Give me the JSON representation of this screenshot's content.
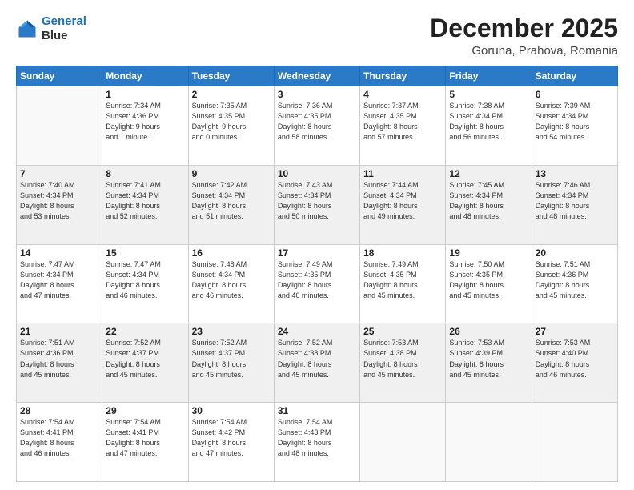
{
  "header": {
    "logo_line1": "General",
    "logo_line2": "Blue",
    "title": "December 2025",
    "subtitle": "Goruna, Prahova, Romania"
  },
  "weekdays": [
    "Sunday",
    "Monday",
    "Tuesday",
    "Wednesday",
    "Thursday",
    "Friday",
    "Saturday"
  ],
  "rows": [
    [
      {
        "day": "",
        "info": ""
      },
      {
        "day": "1",
        "info": "Sunrise: 7:34 AM\nSunset: 4:36 PM\nDaylight: 9 hours\nand 1 minute."
      },
      {
        "day": "2",
        "info": "Sunrise: 7:35 AM\nSunset: 4:35 PM\nDaylight: 9 hours\nand 0 minutes."
      },
      {
        "day": "3",
        "info": "Sunrise: 7:36 AM\nSunset: 4:35 PM\nDaylight: 8 hours\nand 58 minutes."
      },
      {
        "day": "4",
        "info": "Sunrise: 7:37 AM\nSunset: 4:35 PM\nDaylight: 8 hours\nand 57 minutes."
      },
      {
        "day": "5",
        "info": "Sunrise: 7:38 AM\nSunset: 4:34 PM\nDaylight: 8 hours\nand 56 minutes."
      },
      {
        "day": "6",
        "info": "Sunrise: 7:39 AM\nSunset: 4:34 PM\nDaylight: 8 hours\nand 54 minutes."
      }
    ],
    [
      {
        "day": "7",
        "info": "Sunrise: 7:40 AM\nSunset: 4:34 PM\nDaylight: 8 hours\nand 53 minutes."
      },
      {
        "day": "8",
        "info": "Sunrise: 7:41 AM\nSunset: 4:34 PM\nDaylight: 8 hours\nand 52 minutes."
      },
      {
        "day": "9",
        "info": "Sunrise: 7:42 AM\nSunset: 4:34 PM\nDaylight: 8 hours\nand 51 minutes."
      },
      {
        "day": "10",
        "info": "Sunrise: 7:43 AM\nSunset: 4:34 PM\nDaylight: 8 hours\nand 50 minutes."
      },
      {
        "day": "11",
        "info": "Sunrise: 7:44 AM\nSunset: 4:34 PM\nDaylight: 8 hours\nand 49 minutes."
      },
      {
        "day": "12",
        "info": "Sunrise: 7:45 AM\nSunset: 4:34 PM\nDaylight: 8 hours\nand 48 minutes."
      },
      {
        "day": "13",
        "info": "Sunrise: 7:46 AM\nSunset: 4:34 PM\nDaylight: 8 hours\nand 48 minutes."
      }
    ],
    [
      {
        "day": "14",
        "info": "Sunrise: 7:47 AM\nSunset: 4:34 PM\nDaylight: 8 hours\nand 47 minutes."
      },
      {
        "day": "15",
        "info": "Sunrise: 7:47 AM\nSunset: 4:34 PM\nDaylight: 8 hours\nand 46 minutes."
      },
      {
        "day": "16",
        "info": "Sunrise: 7:48 AM\nSunset: 4:34 PM\nDaylight: 8 hours\nand 46 minutes."
      },
      {
        "day": "17",
        "info": "Sunrise: 7:49 AM\nSunset: 4:35 PM\nDaylight: 8 hours\nand 46 minutes."
      },
      {
        "day": "18",
        "info": "Sunrise: 7:49 AM\nSunset: 4:35 PM\nDaylight: 8 hours\nand 45 minutes."
      },
      {
        "day": "19",
        "info": "Sunrise: 7:50 AM\nSunset: 4:35 PM\nDaylight: 8 hours\nand 45 minutes."
      },
      {
        "day": "20",
        "info": "Sunrise: 7:51 AM\nSunset: 4:36 PM\nDaylight: 8 hours\nand 45 minutes."
      }
    ],
    [
      {
        "day": "21",
        "info": "Sunrise: 7:51 AM\nSunset: 4:36 PM\nDaylight: 8 hours\nand 45 minutes."
      },
      {
        "day": "22",
        "info": "Sunrise: 7:52 AM\nSunset: 4:37 PM\nDaylight: 8 hours\nand 45 minutes."
      },
      {
        "day": "23",
        "info": "Sunrise: 7:52 AM\nSunset: 4:37 PM\nDaylight: 8 hours\nand 45 minutes."
      },
      {
        "day": "24",
        "info": "Sunrise: 7:52 AM\nSunset: 4:38 PM\nDaylight: 8 hours\nand 45 minutes."
      },
      {
        "day": "25",
        "info": "Sunrise: 7:53 AM\nSunset: 4:38 PM\nDaylight: 8 hours\nand 45 minutes."
      },
      {
        "day": "26",
        "info": "Sunrise: 7:53 AM\nSunset: 4:39 PM\nDaylight: 8 hours\nand 45 minutes."
      },
      {
        "day": "27",
        "info": "Sunrise: 7:53 AM\nSunset: 4:40 PM\nDaylight: 8 hours\nand 46 minutes."
      }
    ],
    [
      {
        "day": "28",
        "info": "Sunrise: 7:54 AM\nSunset: 4:41 PM\nDaylight: 8 hours\nand 46 minutes."
      },
      {
        "day": "29",
        "info": "Sunrise: 7:54 AM\nSunset: 4:41 PM\nDaylight: 8 hours\nand 47 minutes."
      },
      {
        "day": "30",
        "info": "Sunrise: 7:54 AM\nSunset: 4:42 PM\nDaylight: 8 hours\nand 47 minutes."
      },
      {
        "day": "31",
        "info": "Sunrise: 7:54 AM\nSunset: 4:43 PM\nDaylight: 8 hours\nand 48 minutes."
      },
      {
        "day": "",
        "info": ""
      },
      {
        "day": "",
        "info": ""
      },
      {
        "day": "",
        "info": ""
      }
    ]
  ]
}
